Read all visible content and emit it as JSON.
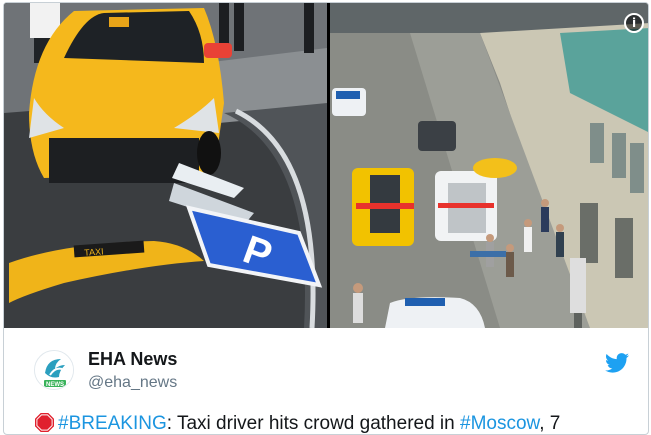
{
  "media": {
    "info_glyph": "i",
    "photos": [
      {
        "name": "taxi-crash-photo",
        "sign_letter": "P",
        "bumper_text": "TAXI"
      },
      {
        "name": "street-ambulance-photo"
      }
    ]
  },
  "author": {
    "name": "EHA News",
    "handle": "@eha_news",
    "avatar_text": "NEWS",
    "avatar_colors": {
      "primary": "#2b9fbf",
      "badge": "#38b25a"
    }
  },
  "tweet": {
    "leading_icon": "stop-sign-icon",
    "hashtag_breaking": "#BREAKING",
    "text_part1": ": Taxi driver hits crowd gathered in ",
    "hashtag_moscow": "#Moscow",
    "text_part2": ", 7"
  },
  "colors": {
    "link": "#1b95e0",
    "twitter_blue": "#1da1f2",
    "handle_gray": "#657786",
    "stop_red": "#e0212e"
  }
}
